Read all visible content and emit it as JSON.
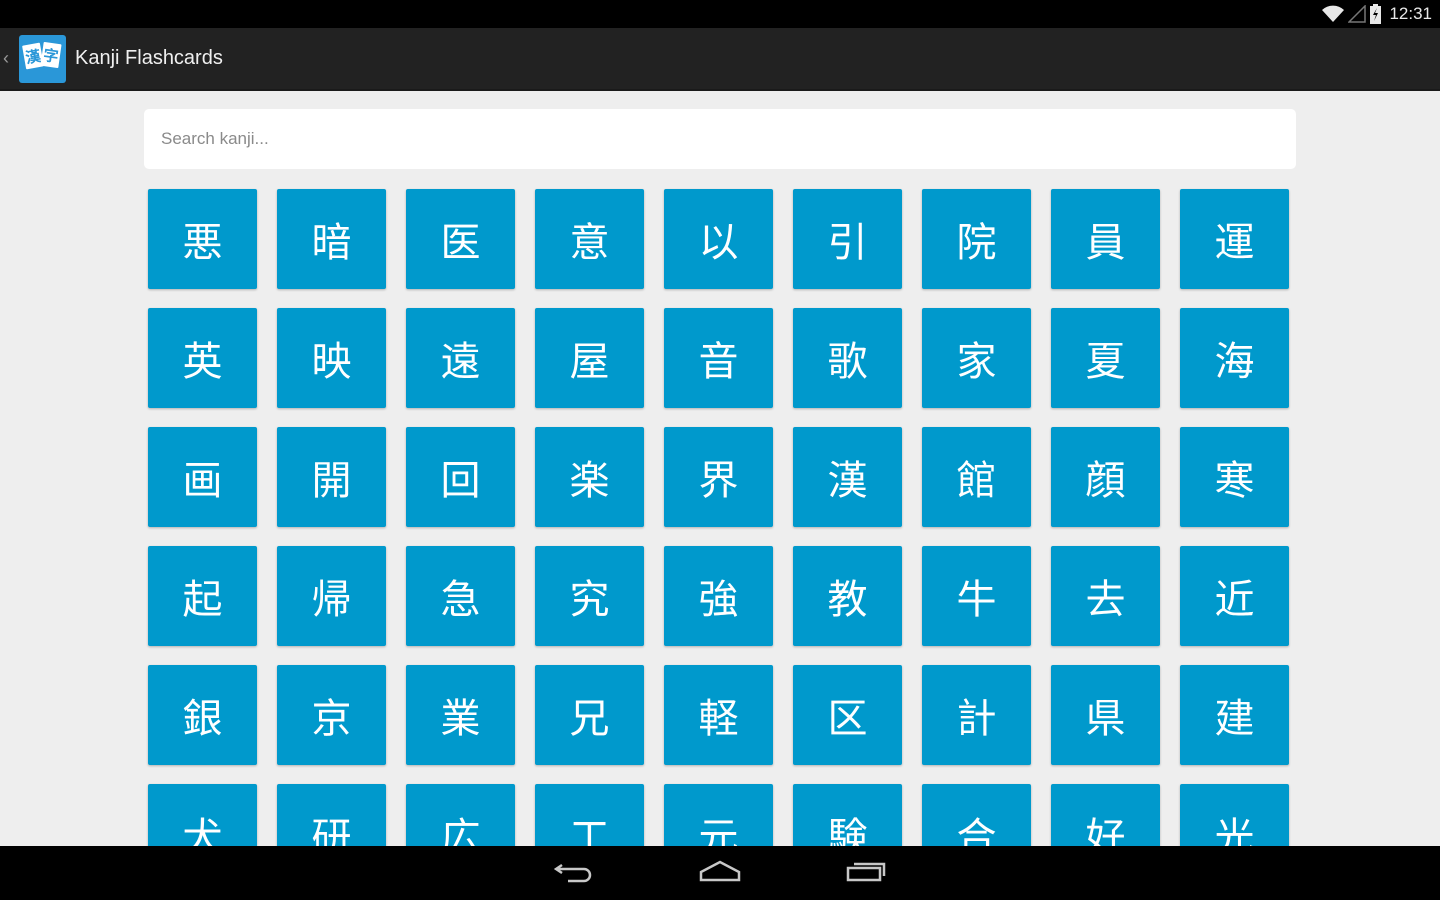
{
  "status_bar": {
    "time": "12:31",
    "icons": [
      "wifi-icon",
      "cell-signal-icon",
      "battery-charging-icon"
    ]
  },
  "action_bar": {
    "title": "Kanji Flashcards",
    "icon_text": [
      "漢",
      "字"
    ],
    "up_caret": "‹"
  },
  "search": {
    "placeholder": "Search kanji...",
    "value": ""
  },
  "colors": {
    "tile": "#0099cc",
    "action_bar": "#222222",
    "background": "#eeeeee"
  },
  "kanji_rows": [
    [
      "悪",
      "暗",
      "医",
      "意",
      "以",
      "引",
      "院",
      "員",
      "運"
    ],
    [
      "英",
      "映",
      "遠",
      "屋",
      "音",
      "歌",
      "家",
      "夏",
      "海"
    ],
    [
      "画",
      "開",
      "回",
      "楽",
      "界",
      "漢",
      "館",
      "顔",
      "寒"
    ],
    [
      "起",
      "帰",
      "急",
      "究",
      "強",
      "教",
      "牛",
      "去",
      "近"
    ],
    [
      "銀",
      "京",
      "業",
      "兄",
      "軽",
      "区",
      "計",
      "県",
      "建"
    ],
    [
      "犬",
      "研",
      "広",
      "工",
      "元",
      "験",
      "合",
      "好",
      "光"
    ]
  ],
  "nav_bar": {
    "buttons": [
      "back",
      "home",
      "recents"
    ]
  }
}
